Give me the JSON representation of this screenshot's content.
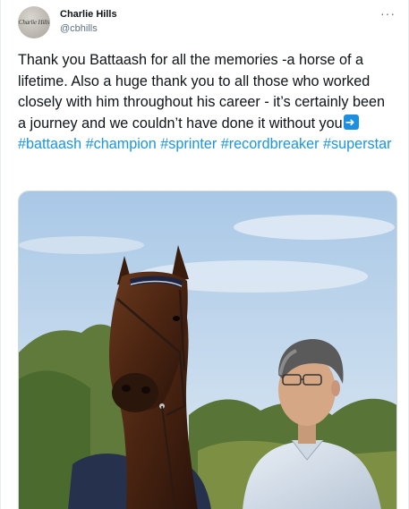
{
  "author": {
    "name": "Charlie Hills",
    "handle": "@cbhills",
    "avatar_text": "Charlie Hills"
  },
  "more_label": "···",
  "tweet": {
    "text": "Thank you Battaash for all the memories -a horse of a lifetime. Also a huge thank you to all those who worked closely with him throughout his career - it’s certainly been a journey and we couldn’t have done it without you",
    "arrow_icon": "right-arrow-emoji",
    "hashtags": "#battaash #champion #sprinter #recordbreaker #superstar"
  },
  "colors": {
    "link": "#1b95e0",
    "text": "#0f1419",
    "secondary": "#5b7083"
  }
}
